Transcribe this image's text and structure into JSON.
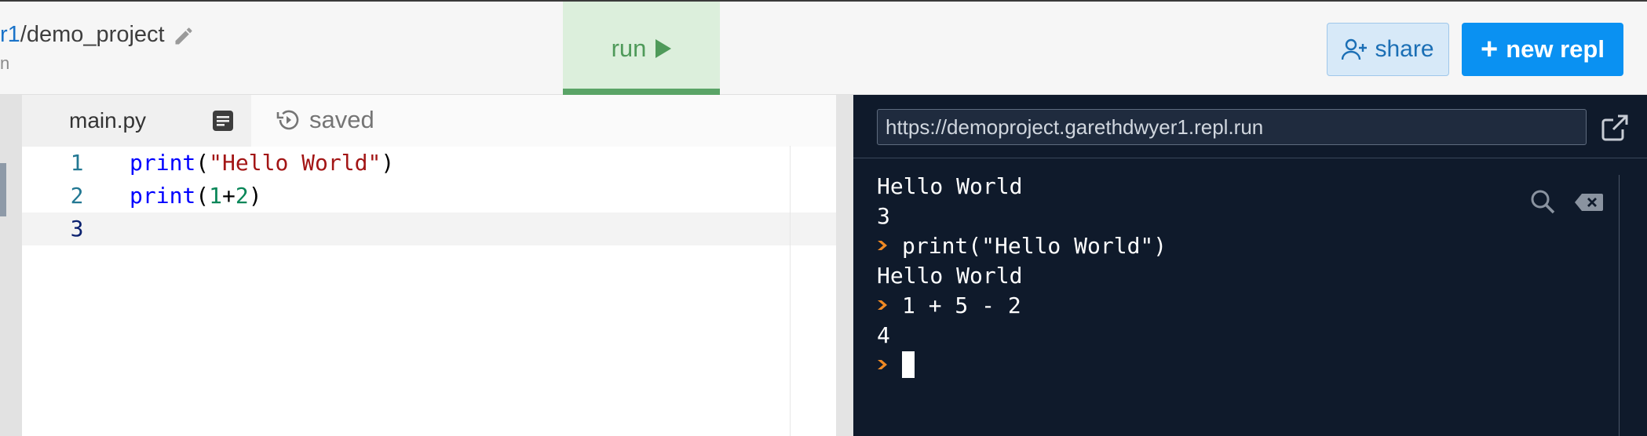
{
  "header": {
    "breadcrumb_user": "r1",
    "breadcrumb_sep": "/",
    "breadcrumb_project": "demo_project",
    "subline": "n",
    "pencil_icon": "pencil-icon",
    "run_label": "run",
    "share_label": "share",
    "new_repl_label": "new repl",
    "accent": "#0a91f2"
  },
  "editor": {
    "file_tab": "main.py",
    "saved_label": "saved",
    "lines": [
      {
        "num": "1",
        "parts": [
          [
            "kw",
            "print"
          ],
          [
            "p",
            "("
          ],
          [
            "str",
            "\"Hello World\""
          ],
          [
            "p",
            ")"
          ]
        ]
      },
      {
        "num": "2",
        "parts": [
          [
            "kw",
            "print"
          ],
          [
            "p",
            "("
          ],
          [
            "num",
            "1"
          ],
          [
            "p",
            "+"
          ],
          [
            "num",
            "2"
          ],
          [
            "p",
            ")"
          ]
        ]
      },
      {
        "num": "3",
        "parts": []
      }
    ]
  },
  "console": {
    "url": "https://demoproject.garethdwyer1.repl.run",
    "output": [
      {
        "type": "out",
        "text": "Hello World"
      },
      {
        "type": "out",
        "text": "3"
      },
      {
        "type": "in",
        "text": "print(\"Hello World\")"
      },
      {
        "type": "out",
        "text": "Hello World"
      },
      {
        "type": "in",
        "text": "1 + 5 - 2"
      },
      {
        "type": "out",
        "text": "4"
      },
      {
        "type": "cursor",
        "text": ""
      }
    ],
    "prompt_color": "#f08a24"
  }
}
